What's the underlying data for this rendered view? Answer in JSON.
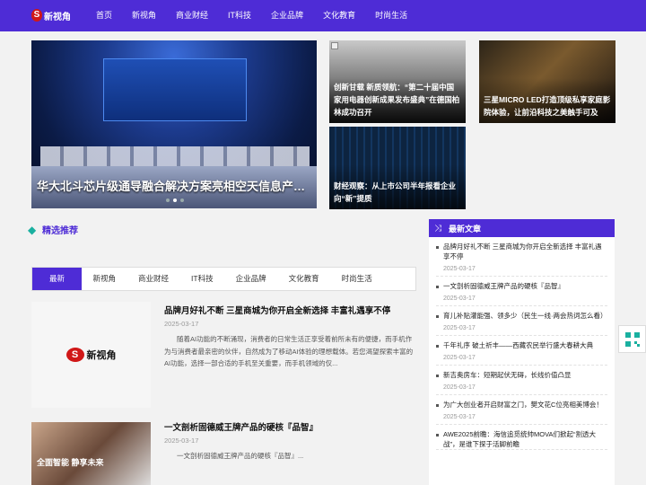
{
  "brand": {
    "mark": "S",
    "name": "新视角"
  },
  "nav": [
    "首页",
    "新视角",
    "商业财经",
    "IT科技",
    "企业品牌",
    "文化教育",
    "时尚生活"
  ],
  "banner": {
    "hero_caption": "华大北斗芯片级通导融合解决方案亮相空天信息产业…",
    "card2_caption": "创新甘载 新质领航：“第二十届中国家用电器创新成果发布盛典”在德国柏林成功召开",
    "card3_caption": "财经观察：从上市公司半年报看企业向“新”提质",
    "card4_caption": "三星MICRO LED打造顶级私享家庭影院体验，让前沿科技之美触手可及"
  },
  "featured": {
    "title": "精选推荐"
  },
  "tabs": [
    "最新",
    "新视角",
    "商业财经",
    "IT科技",
    "企业品牌",
    "文化教育",
    "时尚生活"
  ],
  "articles": [
    {
      "title": "品牌月好礼不断 三星商城为你开启全新选择 丰富礼遇享不停",
      "date": "2025-03-17",
      "body": "随着AI功能的不断涌现，消费者的日常生活正享受着前所未有的便捷，而手机作为与消费者最亲密的伙伴，自然成为了移动AI体验的理想载体。若您渴望探索丰富的AI功能，选择一部合适的手机至关重要，而手机领域的仅..."
    },
    {
      "title": "一文剖析固德威王牌产品的硬核『品智』",
      "date": "2025-03-17",
      "body": "一文剖析固德威王牌产品的硬核『品智』...",
      "thumb_text": "全面智能  静享未来"
    }
  ],
  "sidebar": {
    "title": "最新文章",
    "items": [
      {
        "title": "品牌月好礼不断 三星商城为你开启全新选择 丰富礼遇享不停",
        "date": "2025-03-17"
      },
      {
        "title": "一文剖析固德威王牌产品的硬核『品智』",
        "date": "2025-03-17"
      },
      {
        "title": "育儿补贴灌能强、领多少（民生一线·两会热词怎么看）",
        "date": "2025-03-17"
      },
      {
        "title": "千年礼序 破土祈丰——西藏农民举行盛大春耕大典",
        "date": "2025-03-17"
      },
      {
        "title": "新吉奥房车：短期起伏无碍，长线价值凸显",
        "date": "2025-03-17"
      },
      {
        "title": "为广大创业者开启财富之门，樊文花C位亮相美博会！",
        "date": "2025-03-17"
      },
      {
        "title": "AWE2025前瞻：海信追觅统帅MOVA们掀起“割透大战”，是谁下探于活脚前瞻",
        "date": ""
      }
    ]
  },
  "colors": {
    "primary": "#4e2cd6",
    "accent": "#1ab0a0"
  }
}
